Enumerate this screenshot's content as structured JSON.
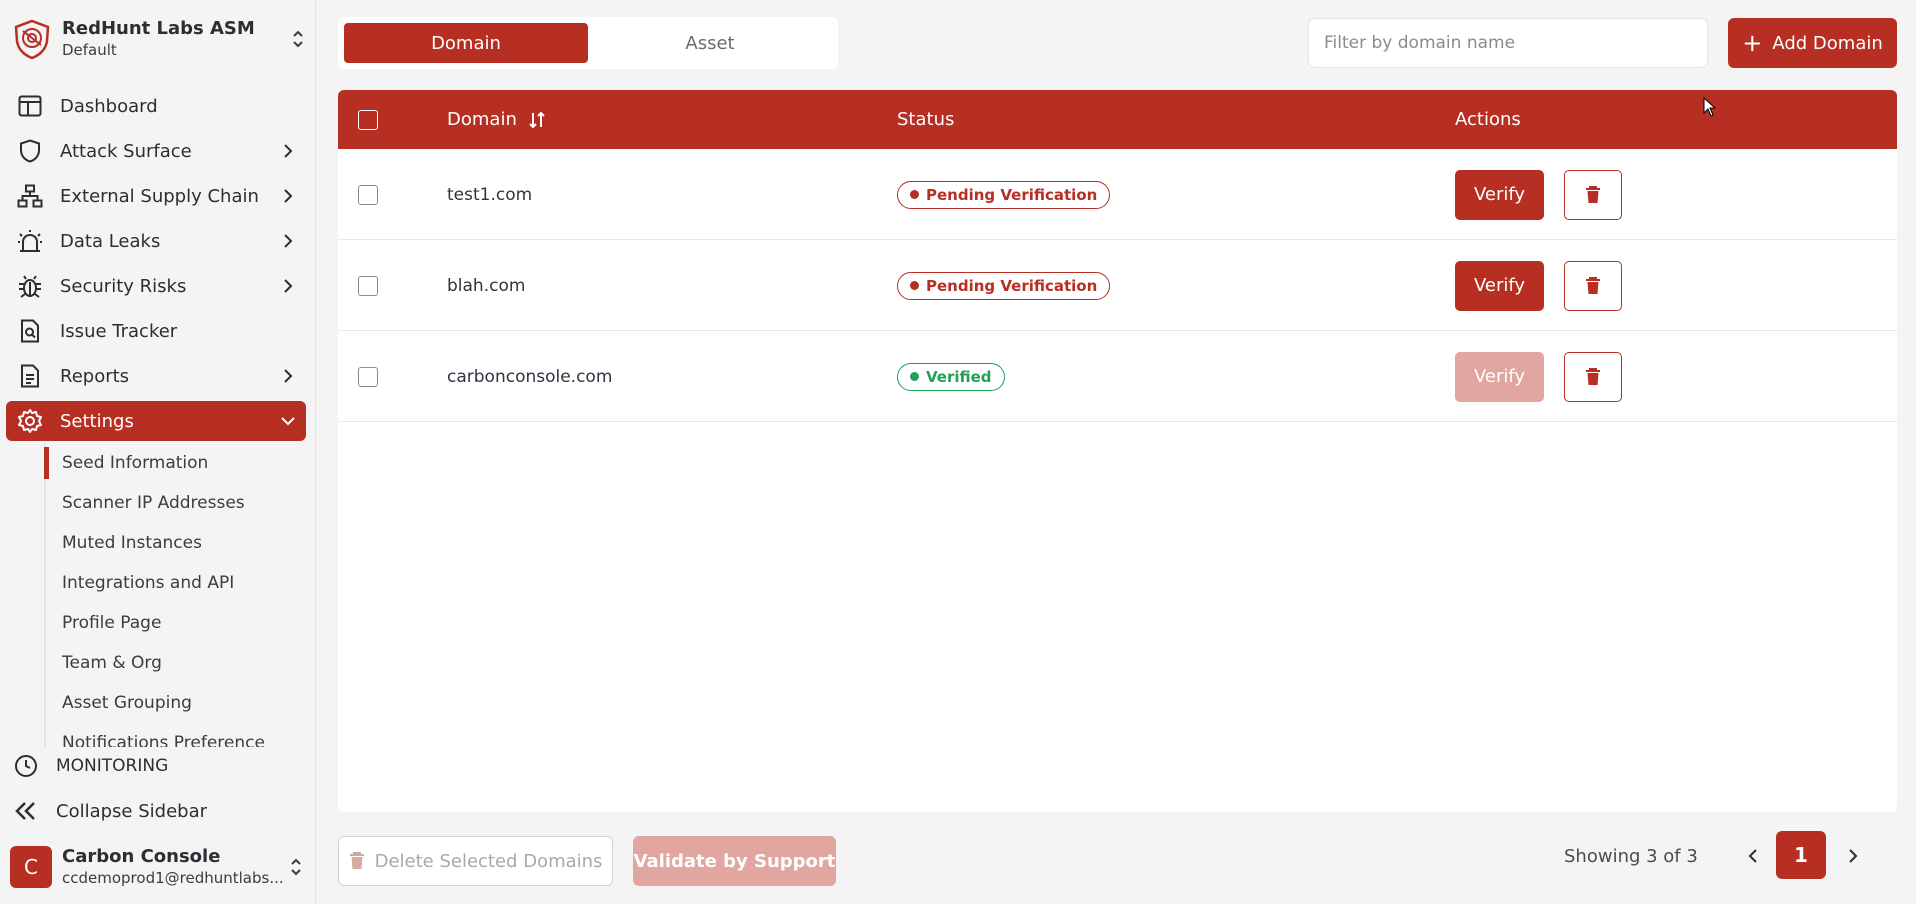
{
  "brand": {
    "title": "RedHunt Labs ASM",
    "subtitle": "Default"
  },
  "nav": {
    "items": [
      {
        "label": "Dashboard",
        "icon": "layout-icon"
      },
      {
        "label": "Attack Surface",
        "icon": "shield-icon"
      },
      {
        "label": "External Supply Chain",
        "icon": "network-icon"
      },
      {
        "label": "Data Leaks",
        "icon": "alarm-icon"
      },
      {
        "label": "Security Risks",
        "icon": "bug-icon"
      },
      {
        "label": "Issue Tracker",
        "icon": "document-search-icon"
      },
      {
        "label": "Reports",
        "icon": "document-icon"
      },
      {
        "label": "Settings",
        "icon": "gear-icon"
      }
    ],
    "settings_sub": [
      "Seed Information",
      "Scanner IP Addresses",
      "Muted Instances",
      "Integrations and API",
      "Profile Page",
      "Team & Org",
      "Asset Grouping",
      "Notifications Preference"
    ],
    "monitoring": "MONITORING",
    "collapse": "Collapse Sidebar"
  },
  "user": {
    "initial": "C",
    "name": "Carbon Console",
    "email": "ccdemoprod1@redhuntlabs..."
  },
  "tabs": {
    "domain": "Domain",
    "asset": "Asset"
  },
  "filter": {
    "placeholder": "Filter by domain name"
  },
  "add_domain": "Add Domain",
  "table": {
    "headers": {
      "domain": "Domain",
      "status": "Status",
      "actions": "Actions"
    },
    "rows": [
      {
        "domain": "test1.com",
        "status": "Pending Verification",
        "verify": "Verify"
      },
      {
        "domain": "blah.com",
        "status": "Pending Verification",
        "verify": "Verify"
      },
      {
        "domain": "carbonconsole.com",
        "status": "Verified",
        "verify": "Verify"
      }
    ]
  },
  "footer": {
    "delete_selected": "Delete Selected Domains",
    "validate": "Validate by Support",
    "showing": "Showing 3 of 3",
    "page": "1"
  },
  "colors": {
    "accent": "#b72f22",
    "accent_disabled": "#e2a6a1",
    "verified": "#22a05a"
  }
}
